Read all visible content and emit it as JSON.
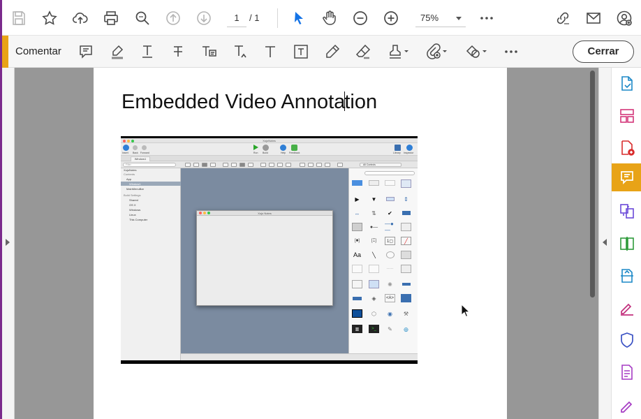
{
  "toolbar": {
    "page_current": "1",
    "page_total": "/ 1",
    "zoom": "75%"
  },
  "comment_bar": {
    "label": "Comentar",
    "close_label": "Cerrar"
  },
  "document": {
    "title_part1": "Embedded Video Annota",
    "title_part2": "tion"
  },
  "embedded_screenshot": {
    "window_title": "XojoNotes",
    "toolbar_labels": [
      "Insert",
      "Back",
      "Forward",
      "Run",
      "Build",
      "Help",
      "Feedback",
      "Library",
      "Inspector"
    ],
    "tab_label": "Window1",
    "filter_placeholder": "Filter",
    "nav_header_contents": "Contents",
    "nav_project": "XojoNotes",
    "nav_items": [
      "App",
      "Window1",
      "MainMenuBar"
    ],
    "nav_header_build": "Build Settings",
    "build_items": [
      "Shared",
      "OS X",
      "Windows",
      "Linux",
      "This Computer"
    ],
    "inner_window_title": "Xojo Notes",
    "library_filter": "All Controls"
  },
  "colors": {
    "accent": "#e8a317",
    "brand_edge": "#7b2a8c",
    "select_tool": "#1473e6"
  }
}
